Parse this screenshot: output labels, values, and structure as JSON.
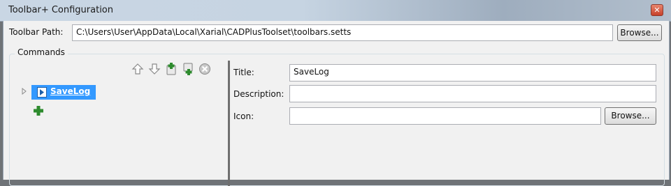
{
  "window": {
    "title": "Toolbar+ Configuration"
  },
  "toolbar_path": {
    "label": "Toolbar Path:",
    "value": "C:\\Users\\User\\AppData\\Local\\Xarial\\CADPlusToolset\\toolbars.setts",
    "browse_label": "Browse..."
  },
  "commands": {
    "legend": "Commands",
    "tools": [
      "move-up-icon",
      "move-down-icon",
      "add-command-icon",
      "add-child-icon",
      "delete-icon"
    ],
    "tree": [
      {
        "label": "SaveLog",
        "selected": true
      }
    ]
  },
  "details": {
    "title_label": "Title:",
    "title_value": "SaveLog",
    "description_label": "Description:",
    "description_value": "",
    "icon_label": "Icon:",
    "icon_value": "",
    "browse_label": "Browse..."
  },
  "colors": {
    "selection": "#3399ff",
    "add_green": "#2e8b2e"
  }
}
